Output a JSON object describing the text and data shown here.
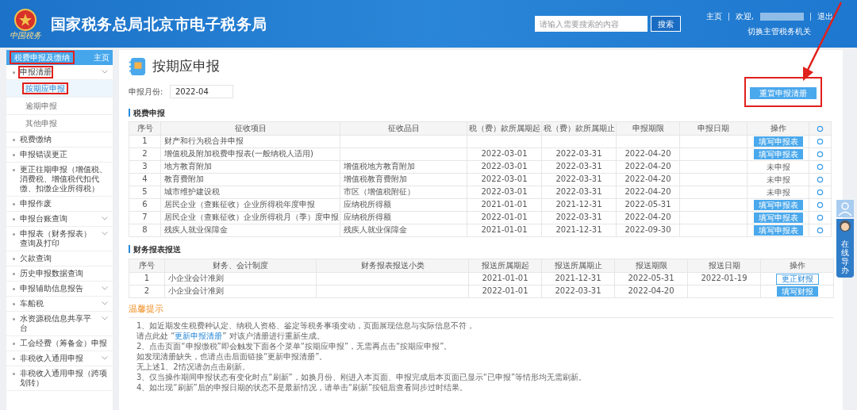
{
  "header": {
    "title": "国家税务总局北京市电子税务局",
    "logo_caption": "中国税务",
    "search": {
      "placeholder": "请输入需要搜索的内容",
      "button": "搜索"
    },
    "links": [
      "主页",
      "欢迎,",
      "退出"
    ],
    "switch_link": "切换主管税务机关"
  },
  "sidebar": {
    "title": "税费申报及缴纳",
    "title_highlighted": true,
    "home": "主页",
    "items": [
      {
        "label": "申报清册",
        "expandable": true,
        "highlighted": true,
        "children": [
          {
            "label": "按期应申报",
            "selected": true,
            "highlighted": true
          },
          {
            "label": "逾期申报",
            "selected": false,
            "highlighted": false
          },
          {
            "label": "其他申报",
            "selected": false,
            "highlighted": false
          }
        ]
      },
      {
        "label": "税费缴纳",
        "expandable": false,
        "highlighted": false
      },
      {
        "label": "申报错误更正",
        "expandable": false,
        "highlighted": false
      },
      {
        "label": "更正往期申报（增值税、消费税、增值税代扣代缴、扣缴企业所得税）",
        "expandable": false,
        "highlighted": false
      },
      {
        "label": "申报作废",
        "expandable": false,
        "highlighted": false
      },
      {
        "label": "申报台账查询",
        "expandable": true,
        "highlighted": false
      },
      {
        "label": "申报表（财务报表）查询及打印",
        "expandable": true,
        "highlighted": false
      },
      {
        "label": "欠款查询",
        "expandable": false,
        "highlighted": false
      },
      {
        "label": "历史申报数据查询",
        "expandable": false,
        "highlighted": false
      },
      {
        "label": "申报辅助信息报告",
        "expandable": true,
        "highlighted": false
      },
      {
        "label": "车船税",
        "expandable": true,
        "highlighted": false
      },
      {
        "label": "水资源税信息共享平台",
        "expandable": true,
        "highlighted": false
      },
      {
        "label": "工会经费（筹备金）申报",
        "expandable": false,
        "highlighted": false
      },
      {
        "label": "非税收入通用申报",
        "expandable": true,
        "highlighted": false
      },
      {
        "label": "非税收入通用申报（跨项划转）",
        "expandable": false,
        "highlighted": false
      }
    ]
  },
  "page": {
    "title": "按期应申报",
    "month_label": "申报月份:",
    "month_value": "2022-04",
    "reset_button": "重置申报清册",
    "reset_highlighted": true
  },
  "tax_table": {
    "title": "税费申报",
    "columns": [
      "序号",
      "征收项目",
      "征收品目",
      "税（费）款所属期起",
      "税（费）款所属期止",
      "申报期限",
      "申报日期",
      "操作"
    ],
    "rows": [
      {
        "cells": [
          "1",
          "财产和行为税合并申报",
          "",
          "",
          "",
          "",
          ""
        ],
        "action": {
          "kind": "button",
          "text": "填写申报表"
        }
      },
      {
        "cells": [
          "2",
          "增值税及附加税费申报表(一般纳税人适用)",
          "",
          "2022-03-01",
          "2022-03-31",
          "2022-04-20",
          ""
        ],
        "action": {
          "kind": "button",
          "text": "填写申报表"
        }
      },
      {
        "cells": [
          "3",
          "地方教育附加",
          "增值税地方教育附加",
          "2022-03-01",
          "2022-03-31",
          "2022-04-20",
          ""
        ],
        "action": {
          "kind": "text",
          "text": "未申报"
        }
      },
      {
        "cells": [
          "4",
          "教育费附加",
          "增值税教育费附加",
          "2022-03-01",
          "2022-03-31",
          "2022-04-20",
          ""
        ],
        "action": {
          "kind": "text",
          "text": "未申报"
        }
      },
      {
        "cells": [
          "5",
          "城市维护建设税",
          "市区（增值税附征）",
          "2022-03-01",
          "2022-03-31",
          "2022-04-20",
          ""
        ],
        "action": {
          "kind": "text",
          "text": "未申报"
        }
      },
      {
        "cells": [
          "6",
          "居民企业（查账征收）企业所得税年度申报",
          "应纳税所得额",
          "2021-01-01",
          "2021-12-31",
          "2022-05-31",
          ""
        ],
        "action": {
          "kind": "button",
          "text": "填写申报表"
        }
      },
      {
        "cells": [
          "7",
          "居民企业（查账征收）企业所得税月（季）度申报",
          "应纳税所得额",
          "2022-01-01",
          "2022-03-31",
          "2022-04-20",
          ""
        ],
        "action": {
          "kind": "button",
          "text": "填写申报表"
        }
      },
      {
        "cells": [
          "8",
          "残疾人就业保障金",
          "残疾人就业保障金",
          "2021-01-01",
          "2021-12-31",
          "2022-09-30",
          ""
        ],
        "action": {
          "kind": "button",
          "text": "填写申报表"
        }
      }
    ]
  },
  "finance_table": {
    "title": "财务报表报送",
    "columns": [
      "序号",
      "财务、会计制度",
      "财务报表报送小类",
      "报送所属期起",
      "报送所属期止",
      "报送期限",
      "报送日期",
      "操作"
    ],
    "rows": [
      {
        "cells": [
          "1",
          "小企业会计准则",
          "",
          "2021-01-01",
          "2021-12-31",
          "2022-05-31",
          "2022-01-19"
        ],
        "action": {
          "kind": "outline",
          "text": "更正财报"
        }
      },
      {
        "cells": [
          "2",
          "小企业会计准则",
          "",
          "2022-01-01",
          "2022-03-31",
          "2022-04-20",
          ""
        ],
        "action": {
          "kind": "button",
          "text": "填写财报"
        }
      }
    ]
  },
  "tips": {
    "title": "温馨提示",
    "lines": [
      "1、如近期发生税费种认定、纳税人资格、鉴定等税务事项变动，页面展现信息与实际信息不符，",
      "请点此处 “**更新申报清册**” 对该户清册进行重新生成。",
      "2、点击页面“申报缴税”即会触发下面各个菜单“按期应申报”，无需再点击“按期应申报”。",
      "如发现清册缺失，也请点击后面链接“更新申报清册”。",
      "无上述1、2情况请勿点击刷新。",
      "3、仅当操作期间申报状态有变化时点“刷新”，如换月份、刚进入本页面、申报完成后本页面已显示“已申报”等情形均无需刷新。",
      "4、如出现“刷新”后的申报日期的状态不是最新情况，请单击“刷新”按钮后查看同步过时结果。"
    ]
  },
  "assistant": {
    "label": "在线导办"
  }
}
